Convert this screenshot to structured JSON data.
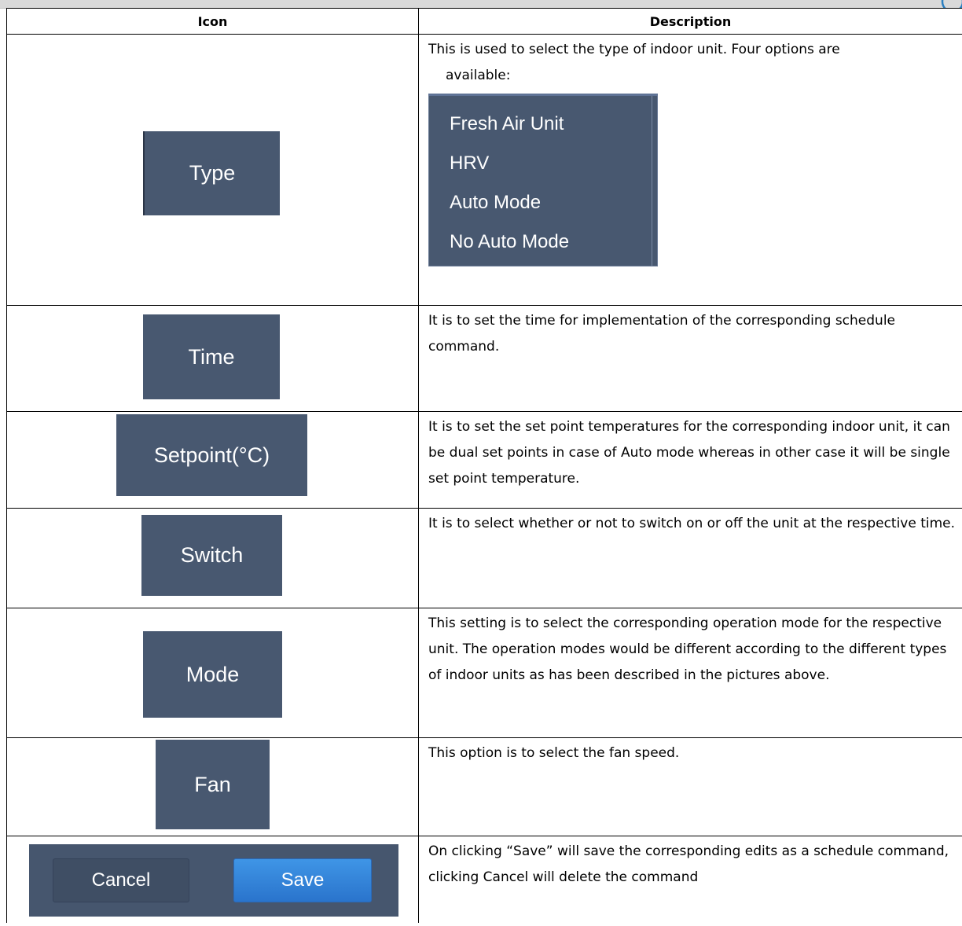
{
  "header": {
    "col_icon": "Icon",
    "col_description": "Description"
  },
  "rows": [
    {
      "button_label": "Type",
      "desc_line1": "This is used to select the type of indoor unit. Four options are",
      "desc_line2": "available:",
      "options": [
        "Fresh Air Unit",
        "HRV",
        "Auto Mode",
        "No Auto Mode"
      ]
    },
    {
      "button_label": "Time",
      "desc": "It is to set the time for implementation of the corresponding schedule command."
    },
    {
      "button_label": "Setpoint(°C)",
      "desc": "It is to set the set point temperatures for the corresponding indoor unit, it can be dual set points in case of Auto mode whereas in other case it will be single set point temperature."
    },
    {
      "button_label": "Switch",
      "desc": "It is to select whether or not to switch on or off the unit at the respective time."
    },
    {
      "button_label": "Mode",
      "desc": "This setting is to select the corresponding operation mode for the respective unit. The operation modes would be different according to the different types of indoor units as has been described in the pictures above."
    },
    {
      "button_label": "Fan",
      "desc": "This option is to select the fan speed."
    },
    {
      "cancel_label": "Cancel",
      "save_label": "Save",
      "desc": "On clicking “Save” will save the corresponding edits as a schedule command, clicking Cancel will delete the command"
    }
  ]
}
